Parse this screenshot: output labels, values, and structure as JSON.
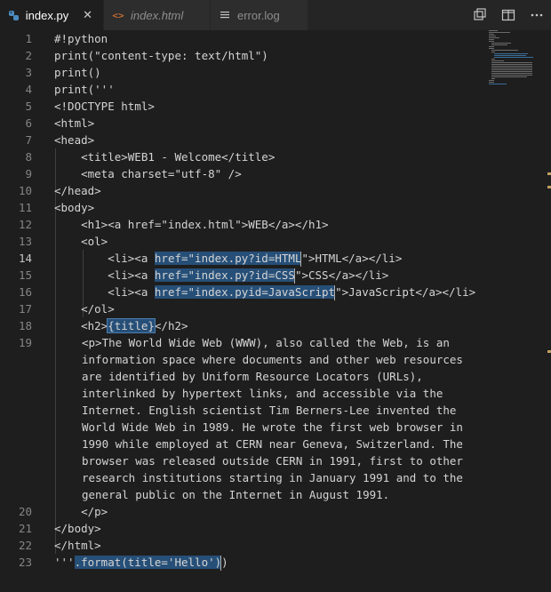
{
  "tabs": [
    {
      "label": "index.py",
      "icon": "python-icon",
      "active": true,
      "closable": true
    },
    {
      "label": "index.html",
      "icon": "html-icon",
      "active": false,
      "italic": true
    },
    {
      "label": "error.log",
      "icon": "log-icon",
      "active": false
    }
  ],
  "actions": [
    "open-changes-icon",
    "split-editor-icon",
    "more-actions-icon"
  ],
  "close_glyph": "✕",
  "line_numbers": [
    "1",
    "2",
    "3",
    "4",
    "5",
    "6",
    "7",
    "8",
    "9",
    "10",
    "11",
    "12",
    "13",
    "14",
    "15",
    "16",
    "17",
    "18",
    "19",
    "20",
    "21",
    "22",
    "23"
  ],
  "current_line": "14",
  "code": {
    "l1": "#!python",
    "l2": "print(\"content-type: text/html\")",
    "l3": "print()",
    "l4": "print('''",
    "l5": "<!DOCTYPE html>",
    "l6": "<html>",
    "l7": "<head>",
    "l8": "    <title>WEB1 - Welcome</title>",
    "l9": "    <meta charset=\"utf-8\" />",
    "l10": "</head>",
    "l11": "<body>",
    "l12": "    <h1><a href=\"index.html\">WEB</a></h1>",
    "l13": "    <ol>",
    "l14a": "        <li><a ",
    "l14b": "href=\"index.py?id=HTML",
    "l14c": "\">HTML</a></li>",
    "l15a": "        <li><a ",
    "l15b": "href=\"index.py?id=CSS",
    "l15c": "\">CSS</a></li>",
    "l16a": "        <li><a ",
    "l16b": "href=\"index.pyid=JavaScript",
    "l16c": "\">JavaScript</a></li>",
    "l17": "    </ol>",
    "l18a": "    <h2>",
    "l18b": "{title}",
    "l18c": "</h2>",
    "l19": "<p>The World Wide Web (WWW), also called the Web, is an information space where documents and other web resources are identified by Uniform Resource Locators (URLs), interlinked by hypertext links, and accessible via the Internet. English scientist Tim Berners-Lee invented the World Wide Web in 1989. He wrote the first web browser in 1990 while employed at CERN near Geneva, Switzerland. The browser was released outside CERN in 1991, first to other research institutions starting in January 1991 and to the general public on the Internet in August 1991.",
    "l20": "    </p>",
    "l21": "</body>",
    "l22": "</html>",
    "l23a": "'''",
    "l23b": ".format(title='Hello')",
    "l23c": ")"
  },
  "colors": {
    "selection": "#264f78",
    "scroll_marker": "#c0a060",
    "python_icon": "#4b8bbe",
    "html_icon": "#e37933"
  }
}
